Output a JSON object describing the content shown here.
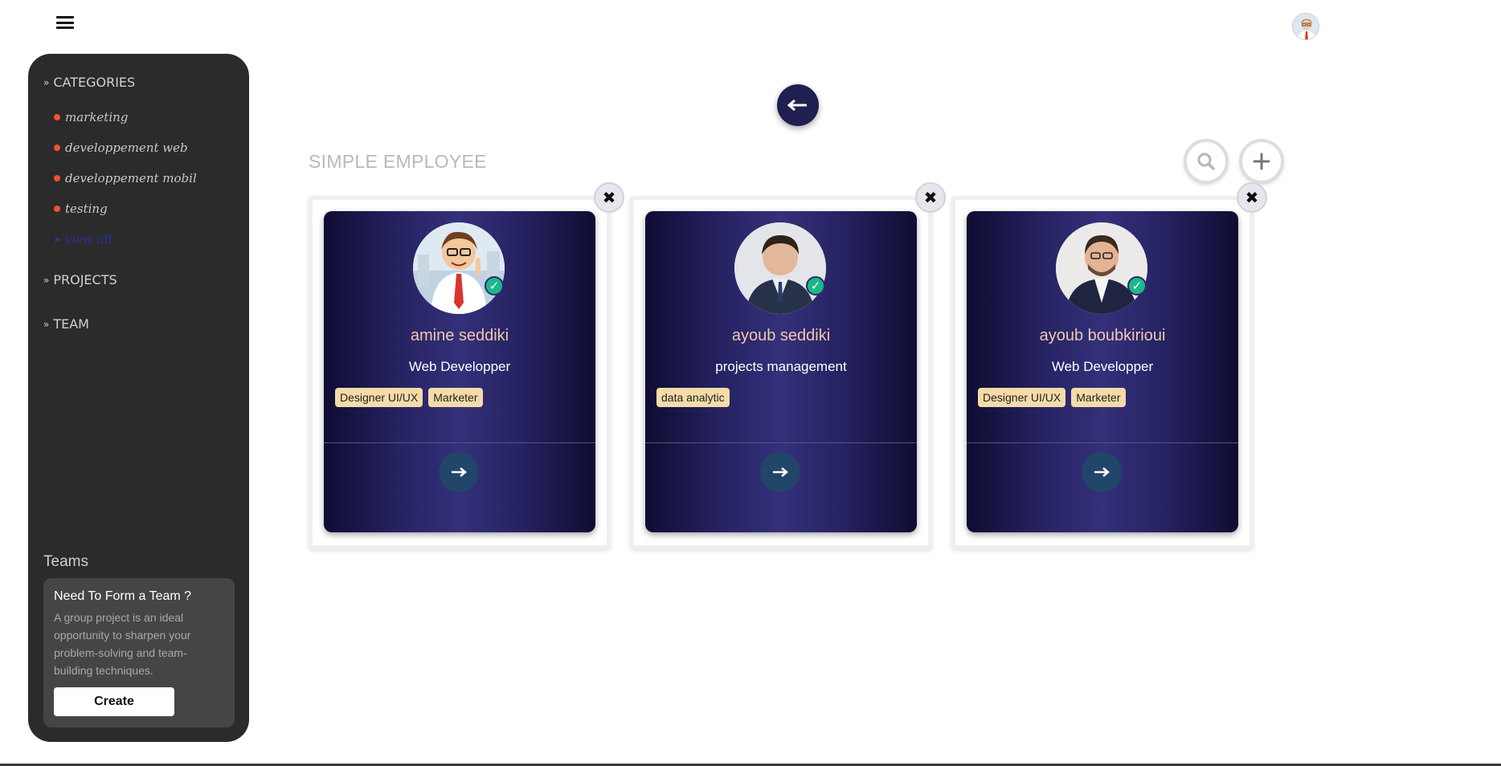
{
  "topbar": {
    "menu_icon": "hamburger-icon",
    "avatar_icon": "user-avatar"
  },
  "sidebar": {
    "categories_label": "CATEGORIES",
    "categories": [
      "marketing",
      "developpement web",
      "developpement mobil",
      "testing"
    ],
    "view_all_label": "view all",
    "projects_label": "PROJECTS",
    "team_label": "TEAM",
    "teams_title": "Teams",
    "team_card": {
      "title": "Need To Form a Team ?",
      "description": "A group project is an ideal opportunity to sharpen your problem-solving and team-building techniques.",
      "create_label": "Create"
    }
  },
  "main": {
    "title": "SIMPLE EMPLOYEE",
    "back_icon": "arrow-left-icon",
    "search_icon": "search-icon",
    "add_icon": "plus-icon"
  },
  "employees": [
    {
      "name": "amine seddiki",
      "role": "Web Developper",
      "tags": [
        "Designer UI/UX",
        "Marketer"
      ]
    },
    {
      "name": "ayoub seddiki",
      "role": "projects management",
      "tags": [
        "data analytic"
      ]
    },
    {
      "name": "ayoub boubkirioui",
      "role": "Web Developper",
      "tags": [
        "Designer UI/UX",
        "Marketer"
      ]
    }
  ],
  "colors": {
    "sidebar_bg": "#2b2b2b",
    "category_dot": "#f0532f",
    "card_gradient_dark": "#0f0c32",
    "card_gradient_light": "#34307a",
    "name_color": "#f1c9a9",
    "tag_bg": "#f4dba9",
    "verified": "#1db78a",
    "go_button": "#22456a"
  }
}
